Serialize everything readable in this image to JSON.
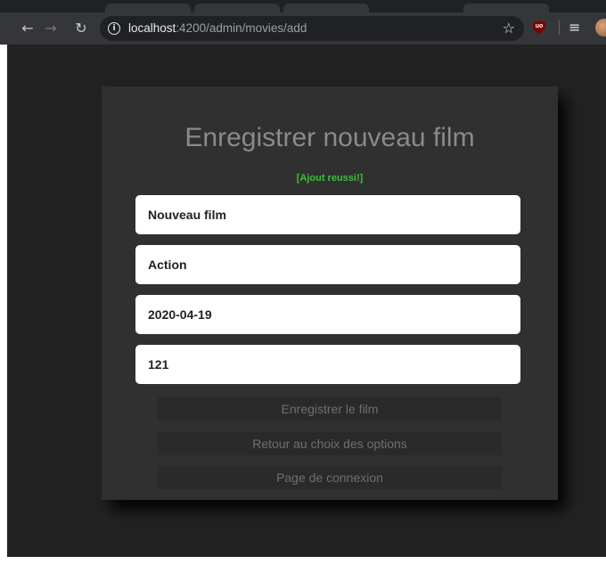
{
  "browser": {
    "url_host": "localhost",
    "url_rest": ":4200/admin/movies/add",
    "icons": {
      "back": "arrow-back-icon",
      "forward": "arrow-forward-icon",
      "reload": "reload-icon",
      "site_info": "info-icon",
      "bookmark": "star-icon",
      "extension": "ublock-icon",
      "reading_list": "list-icon",
      "profile": "avatar"
    }
  },
  "form": {
    "title": "Enregistrer nouveau film",
    "status": "[Ajout reussi!]",
    "status_color": "#3fbf3f",
    "fields": {
      "title_value": "Nouveau film",
      "genre_value": "Action",
      "date_value": "2020-04-19",
      "duration_value": "121"
    },
    "buttons": {
      "save": "Enregistrer le film",
      "back_options": "Retour au choix des options",
      "login": "Page de connexion"
    }
  },
  "colors": {
    "page_background": "#222222",
    "card_background": "#303030",
    "title_text": "#8a8a8a",
    "button_background": "#2a2a2a",
    "button_text": "#6e6e6e"
  }
}
